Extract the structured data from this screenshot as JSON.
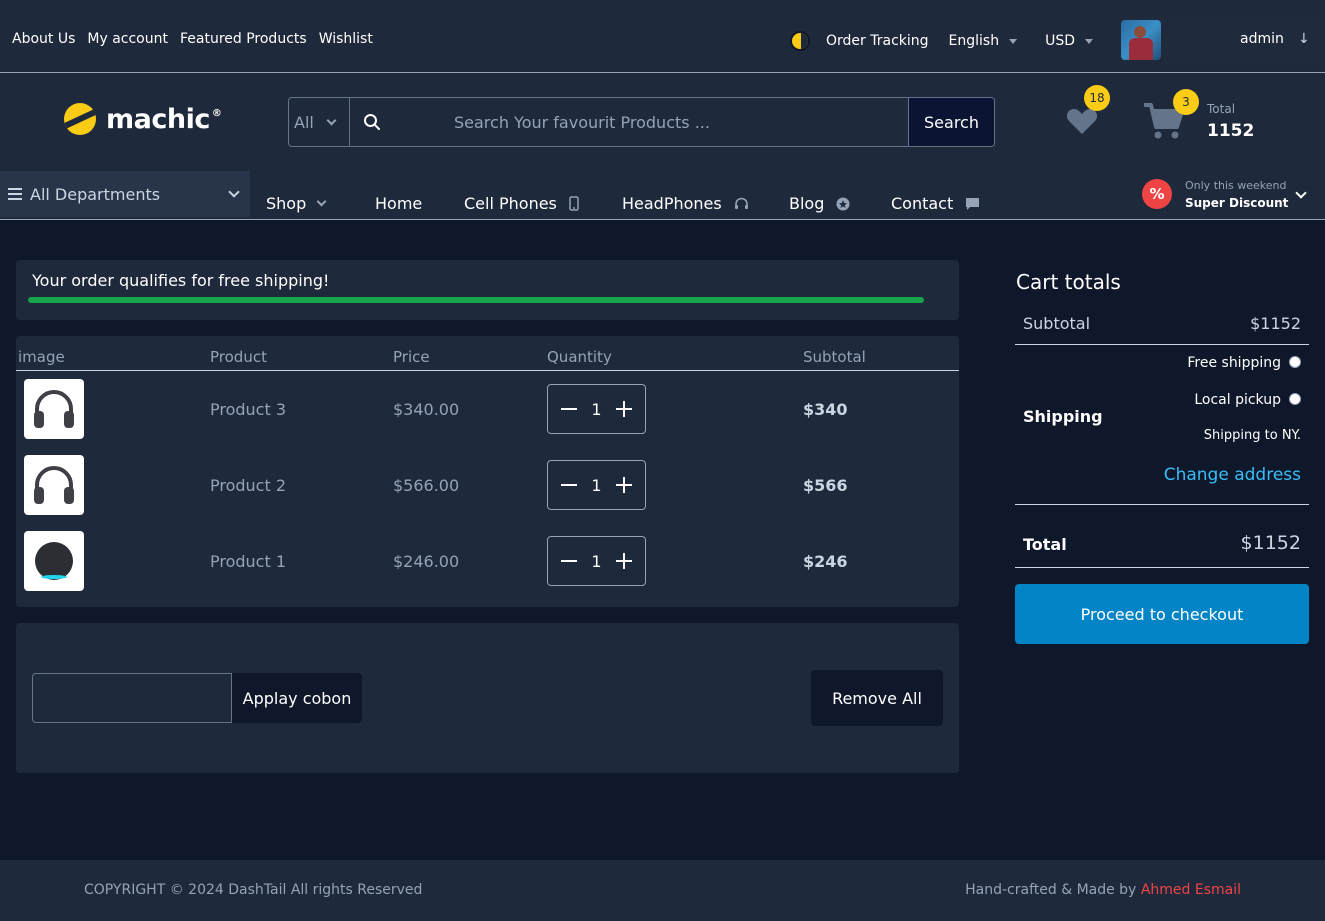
{
  "topbar": {
    "links": [
      "About Us",
      "My account",
      "Featured Products",
      "Wishlist"
    ],
    "order_tracking": "Order Tracking",
    "language": "English",
    "currency": "USD",
    "username": "admin"
  },
  "header": {
    "logo": "machic",
    "logo_mark": "®",
    "search_category": "All",
    "search_placeholder": "Search Your favourit Products ...",
    "search_button": "Search",
    "wishlist_count": "18",
    "cart_count": "3",
    "total_label": "Total",
    "total_value": "1152"
  },
  "nav": {
    "departments": "All Departments",
    "items": [
      {
        "label": "Shop",
        "icon": "chevron-down-icon"
      },
      {
        "label": "Home",
        "icon": ""
      },
      {
        "label": "Cell Phones",
        "icon": "phone-icon"
      },
      {
        "label": "HeadPhones",
        "icon": "headphones-icon"
      },
      {
        "label": "Blog",
        "icon": "blog-icon"
      },
      {
        "label": "Contact",
        "icon": "chat-icon"
      }
    ],
    "promo_sub": "Only this weekend",
    "promo_main": "Super Discount"
  },
  "shipping_notice": {
    "message": "Your order qualifies for free shipping!",
    "progress_percent": 100
  },
  "cart_table": {
    "headers": [
      "image",
      "Product",
      "Price",
      "Quantity",
      "Subtotal"
    ],
    "rows": [
      {
        "name": "Product 3",
        "price": "$340.00",
        "qty": "1",
        "subtotal": "$340",
        "image": "headphones"
      },
      {
        "name": "Product 2",
        "price": "$566.00",
        "qty": "1",
        "subtotal": "$566",
        "image": "headphones"
      },
      {
        "name": "Product 1",
        "price": "$246.00",
        "qty": "1",
        "subtotal": "$246",
        "image": "smart-speaker"
      }
    ]
  },
  "coupon": {
    "button": "Applay cobon",
    "remove_all": "Remove All"
  },
  "totals": {
    "title": "Cart totals",
    "subtotal_label": "Subtotal",
    "subtotal_value": "$1152",
    "shipping_label": "Shipping",
    "free_shipping": "Free shipping",
    "local_pickup": "Local pickup",
    "shipping_to": "Shipping to NY.",
    "change_address": "Change address",
    "total_label": "Total",
    "total_value": "$1152",
    "checkout": "Proceed to checkout"
  },
  "footer": {
    "copyright": "COPYRIGHT © 2024 DashTail All rights Reserved",
    "credit_prefix": "Hand-crafted & Made by",
    "credit_name": "Ahmed Esmail"
  },
  "colors": {
    "accent_yellow": "#facc15",
    "progress_green": "#16a34a",
    "checkout_blue": "#0284c7",
    "link_blue": "#38bdf8",
    "credit_red": "#ef4444"
  }
}
